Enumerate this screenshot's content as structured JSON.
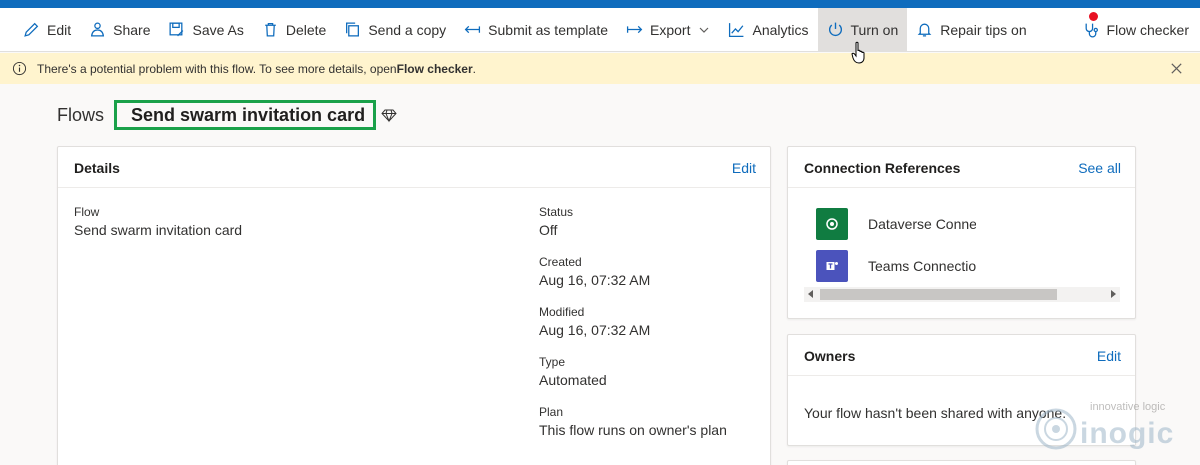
{
  "commandbar": {
    "items": [
      {
        "label": "Edit",
        "icon": "pencil-icon"
      },
      {
        "label": "Share",
        "icon": "share-icon"
      },
      {
        "label": "Save As",
        "icon": "save-as-icon"
      },
      {
        "label": "Delete",
        "icon": "trash-icon"
      },
      {
        "label": "Send a copy",
        "icon": "copy-icon"
      },
      {
        "label": "Submit as template",
        "icon": "submit-template-icon"
      },
      {
        "label": "Export",
        "icon": "export-icon"
      },
      {
        "label": "Analytics",
        "icon": "analytics-icon"
      },
      {
        "label": "Turn on",
        "icon": "power-icon"
      },
      {
        "label": "Repair tips on",
        "icon": "bell-icon"
      }
    ],
    "flow_checker": "Flow checker"
  },
  "warning": {
    "text": "There's a potential problem with this flow. To see more details, open ",
    "link": "Flow checker",
    "suffix": "."
  },
  "breadcrumb": {
    "root": "Flows",
    "title": "Send swarm invitation card"
  },
  "details": {
    "title": "Details",
    "edit": "Edit",
    "flow_label": "Flow",
    "flow_value": "Send swarm invitation card",
    "status_label": "Status",
    "status_value": "Off",
    "created_label": "Created",
    "created_value": "Aug 16, 07:32 AM",
    "modified_label": "Modified",
    "modified_value": "Aug 16, 07:32 AM",
    "type_label": "Type",
    "type_value": "Automated",
    "plan_label": "Plan",
    "plan_value": "This flow runs on owner's plan"
  },
  "connections": {
    "title": "Connection References",
    "see_all": "See all",
    "items": [
      {
        "name": "Dataverse Connection",
        "color": "#107c41"
      },
      {
        "name": "Teams Connection",
        "color": "#4b53bc"
      }
    ]
  },
  "owners": {
    "title": "Owners",
    "edit": "Edit",
    "message": "Your flow hasn't been shared with anyone."
  },
  "watermark": {
    "tagline": "innovative logic",
    "brand": "inogic"
  },
  "colors": {
    "accent": "#0f6cbd",
    "warning_bg": "#fff4ce",
    "highlight_border": "#1aa14a"
  }
}
